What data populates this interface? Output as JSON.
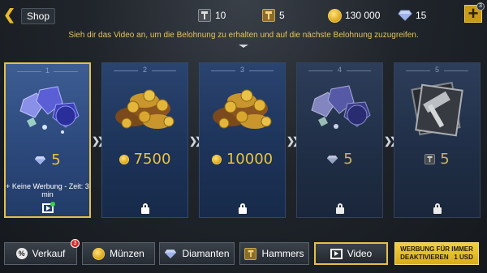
{
  "header": {
    "back_icon": "chevron-left-icon",
    "shop_label": "Shop",
    "resources": [
      {
        "icon": "hammer-icon",
        "value": "10"
      },
      {
        "icon": "gold-hammer-icon",
        "value": "5"
      },
      {
        "icon": "coin-icon",
        "value": "130 000"
      },
      {
        "icon": "diamond-icon",
        "value": "15"
      }
    ],
    "plus_badge": "3"
  },
  "info_text": "Sieh dir das Video an, um die Belohnung zu erhalten und auf die nächste Belohnung zuzugreifen.",
  "rewards": [
    {
      "num": "1",
      "icon": "diamond-icon",
      "value": "5",
      "note": "+ Keine Werbung - Zeit: 3 min",
      "status": "video"
    },
    {
      "num": "2",
      "icon": "coin-icon",
      "value": "7500",
      "status": "locked"
    },
    {
      "num": "3",
      "icon": "coin-icon",
      "value": "10000",
      "status": "locked"
    },
    {
      "num": "4",
      "icon": "diamond-icon",
      "value": "5",
      "status": "locked"
    },
    {
      "num": "5",
      "icon": "hammer-icon",
      "value": "5",
      "status": "locked"
    }
  ],
  "tabs": {
    "verkauf": "Verkauf",
    "verkauf_badge": "3",
    "muenzen": "Münzen",
    "diamanten": "Diamanten",
    "hammers": "Hammers",
    "video": "Video",
    "promo_line1": "WERBUNG FÜR IMMER",
    "promo_line2": "DEAKTIVIEREN   1 USD"
  },
  "colors": {
    "accent_gold": "#e4c04a",
    "card_blue": "#1c3257",
    "value_gold": "#e8c443"
  }
}
